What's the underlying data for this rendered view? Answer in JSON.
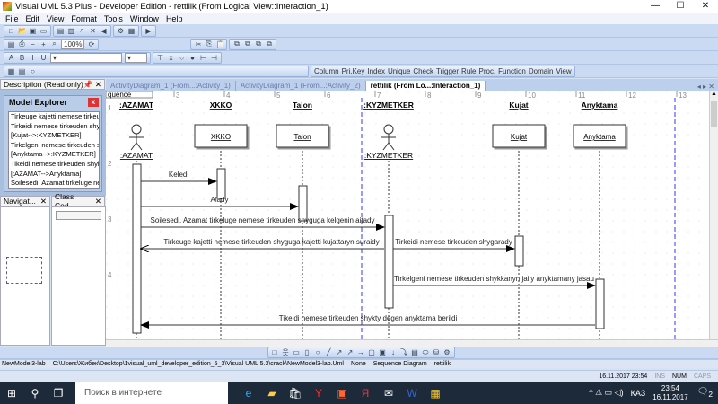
{
  "window": {
    "title": "Visual UML 5.3 Plus - Developer Edition - rettilik (From Logical View::Interaction_1)",
    "minimize": "—",
    "maximize": "☐",
    "close": "✕"
  },
  "menu": [
    "File",
    "Edit",
    "View",
    "Format",
    "Tools",
    "Window",
    "Help"
  ],
  "toolbar": {
    "zoom": "100%",
    "db_buttons": [
      "Column",
      "Pri.Key",
      "Index",
      "Unique",
      "Check",
      "Trigger",
      "Rule",
      "Proc.",
      "Function",
      "Domain",
      "View"
    ]
  },
  "panels": {
    "description": "Description (Read only)",
    "model_explorer": {
      "title": "Model Explorer",
      "items": [
        "Tirkeuge kajetti nemese tirkeuden",
        "Tirkeidi nemese tirkeuden shygara",
        "[Kujat-->:KYZMETKER]",
        "Tirkelgeni nemese tirkeuden shyk",
        "[Anyktama-->:KYZMETKER]",
        "Tikeldi nemese tirkeuden shykty d",
        "[:AZAMAT-->Anyktama]",
        "Soilesedi. Azamat tirkeluge nemes"
      ]
    },
    "navigator": "Navigat...",
    "class_code": "Class Cod..."
  },
  "tabs": [
    {
      "label": "ActivityDiagram_1 (From...:Activity_1)"
    },
    {
      "label": "ActivityDiagram_1 (From...:Activity_2)"
    },
    {
      "label": "rettilik (From Lo...:Interaction_1)",
      "active": true
    }
  ],
  "diagram": {
    "frame_label": "quence",
    "ruler_cols": [
      "2",
      "3",
      "4",
      "5",
      "6",
      "7",
      "8",
      "9",
      "10",
      "11",
      "12",
      "13"
    ],
    "ruler_rows": [
      "1",
      "2",
      "3",
      "4"
    ],
    "lifelines": [
      {
        "id": "azamat",
        "header": ":AZAMAT",
        "label": ":AZAMAT",
        "kind": "actor"
      },
      {
        "id": "xkko",
        "header": "XKKO",
        "label": "XKKO",
        "kind": "object"
      },
      {
        "id": "talon",
        "header": "Talon",
        "label": "Talon",
        "kind": "object"
      },
      {
        "id": "kyzmetker",
        "header": ":KYZMETKER",
        "label": ":KYZMETKER",
        "kind": "actor"
      },
      {
        "id": "kujat",
        "header": "Kujat",
        "label": "Kujat",
        "kind": "object"
      },
      {
        "id": "anyktama",
        "header": "Anyktama",
        "label": "Anyktama",
        "kind": "object"
      }
    ],
    "messages": [
      {
        "from": "azamat",
        "to": "xkko",
        "text": "Keledi"
      },
      {
        "from": "azamat",
        "to": "talon",
        "text": "Alady"
      },
      {
        "from": "azamat",
        "to": "kyzmetker",
        "text": "Soilesedi. Azamat tirkeluge nemese tirkeuden shyguga kelgenin aitady"
      },
      {
        "from": "kyzmetker",
        "to": "azamat",
        "text": "Tirkeuge kajetti nemese tirkeuden shyguga kajetti kujattaryn suraidy"
      },
      {
        "from": "kyzmetker",
        "to": "kujat",
        "text": "Tirkeidi nemese tirkeuden shygarady"
      },
      {
        "from": "kyzmetker",
        "to": "anyktama",
        "text": "Tirkelgeni nemese tirkeuden shykkanyn jaily anyktamany jasau"
      },
      {
        "from": "anyktama",
        "to": "azamat",
        "text": "Tikeldi nemese tirkeuden shykty degen anyktama berildi"
      }
    ]
  },
  "status": {
    "fields": [
      "NewModel3-lab",
      "C:\\Users\\Жибек\\Desktop\\1visual_uml_developer_edition_5_3\\Visual UML 5.3\\crack\\NewModel3-lab.Uml",
      "None",
      "Sequence Diagram",
      "rettilik"
    ],
    "datetime": "16.11.2017  23:54",
    "ins": "INS",
    "num": "NUM",
    "caps": "CAPS"
  },
  "taskbar": {
    "search_placeholder": "Поиск в интернете",
    "lang": "КАЗ",
    "time": "23:54",
    "date": "16.11.2017",
    "notif_count": "2"
  }
}
